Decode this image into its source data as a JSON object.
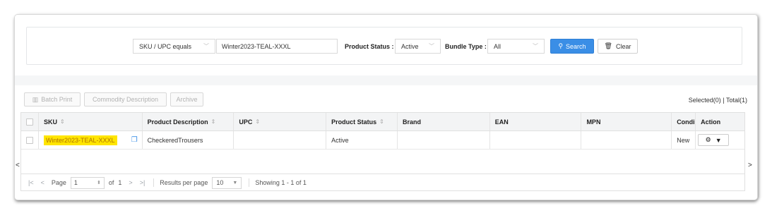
{
  "search": {
    "field_select": "SKU / UPC equals",
    "query_value": "Winter2023-TEAL-XXXL",
    "product_status_label": "Product Status :",
    "product_status_value": "Active",
    "bundle_type_label": "Bundle Type :",
    "bundle_type_value": "All",
    "search_button": "Search",
    "clear_button": "Clear"
  },
  "toolbar": {
    "batch_print": "Batch Print",
    "commodity_description": "Commodity Description",
    "archive": "Archive",
    "counter": "Selected(0) | Total(1)"
  },
  "table": {
    "headers": [
      "SKU",
      "Product Description",
      "UPC",
      "Product Status",
      "Brand",
      "EAN",
      "MPN",
      "Condi",
      "Action"
    ],
    "rows": [
      {
        "sku": "Winter2023-TEAL-XXXL",
        "description": "CheckeredTrousers",
        "upc": "",
        "status": "Active",
        "brand": "",
        "ean": "",
        "mpn": "",
        "condition": "New"
      }
    ]
  },
  "pager": {
    "page_label": "Page",
    "page_value": "1",
    "of_label": "of",
    "total_pages": "1",
    "results_label": "Results per page",
    "results_value": "10",
    "showing": "Showing 1 - 1 of 1"
  },
  "colors": {
    "primary": "#3a8ee6",
    "highlight": "#ffe500"
  }
}
